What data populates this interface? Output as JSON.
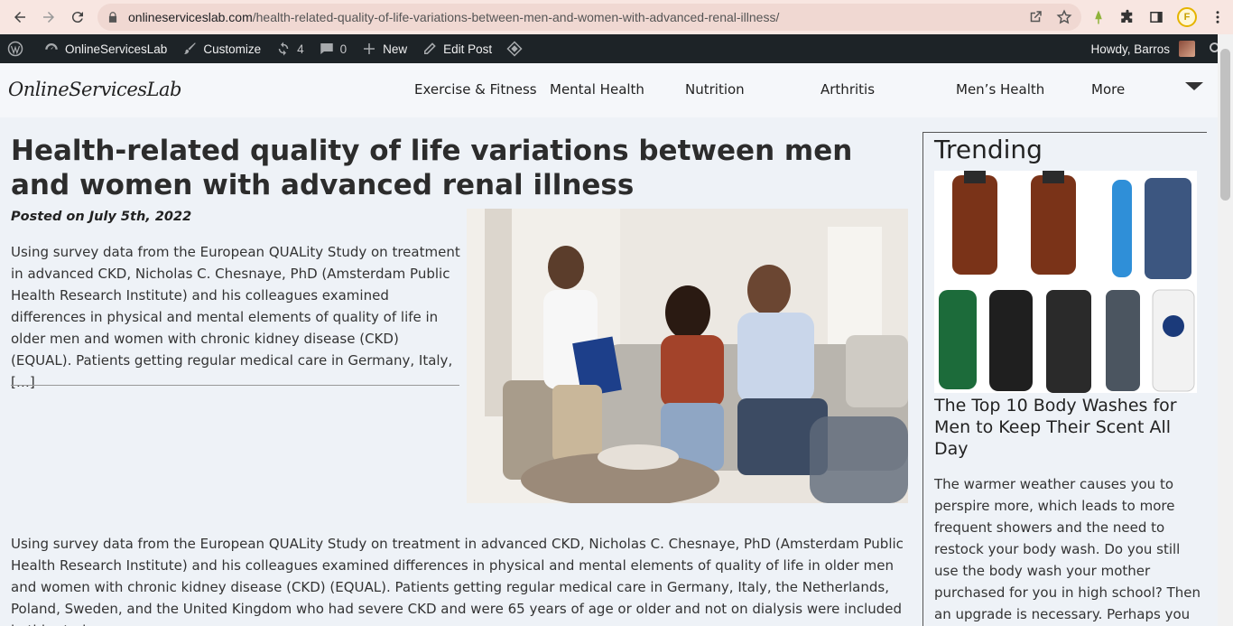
{
  "browser": {
    "url_domain": "onlineserviceslab.com",
    "url_path": "/health-related-quality-of-life-variations-between-men-and-women-with-advanced-renal-illness/",
    "profile_initial": "F"
  },
  "adminbar": {
    "site_name": "OnlineServicesLab",
    "customize": "Customize",
    "updates_count": "4",
    "comments_count": "0",
    "new_label": "New",
    "edit_post": "Edit Post",
    "howdy": "Howdy, Barros"
  },
  "site": {
    "logo": "OnlineServicesLab",
    "menu": [
      "Exercise & Fitness",
      "Mental Health",
      "Nutrition",
      "Arthritis",
      "Men’s Health",
      "More"
    ]
  },
  "article": {
    "title": "Health-related quality of life variations between men and women with advanced renal illness",
    "posted": "Posted on July 5th, 2022",
    "excerpt": "Using survey data from the European QUALity Study on treatment in advanced CKD, Nicholas C. Chesnaye, PhD (Amsterdam Public Health Research Institute) and his colleagues examined differences in physical and mental elements of quality of life in older men and women with chronic kidney disease (CKD) (EQUAL). Patients getting regular medical care in Germany, Italy, […]",
    "body": "Using survey data from the European QUALity Study on treatment in advanced CKD, Nicholas C. Chesnaye, PhD (Amsterdam Public Health Research Institute) and his colleagues examined differences in physical and mental elements of quality of life in older men and women with chronic kidney disease (CKD) (EQUAL). Patients getting regular medical care in Germany, Italy, the Netherlands, Poland, Sweden, and the United Kingdom who had severe CKD and were 65 years of age or older and not on dialysis were included in this study."
  },
  "sidebar": {
    "title": "Trending",
    "headline": "The Top 10 Body Washes for Men to Keep Their Scent All Day",
    "text": "The warmer weather causes you to perspire more, which leads to more frequent showers and the need to restock your body wash. Do you still use the body wash your mother purchased for you in high school? Then an upgrade is necessary. Perhaps you like using bar"
  },
  "colors": {
    "adminbar_bg": "#1d2327",
    "browser_bar_bg": "#f8e6e1",
    "page_bg": "#eef2f7"
  }
}
